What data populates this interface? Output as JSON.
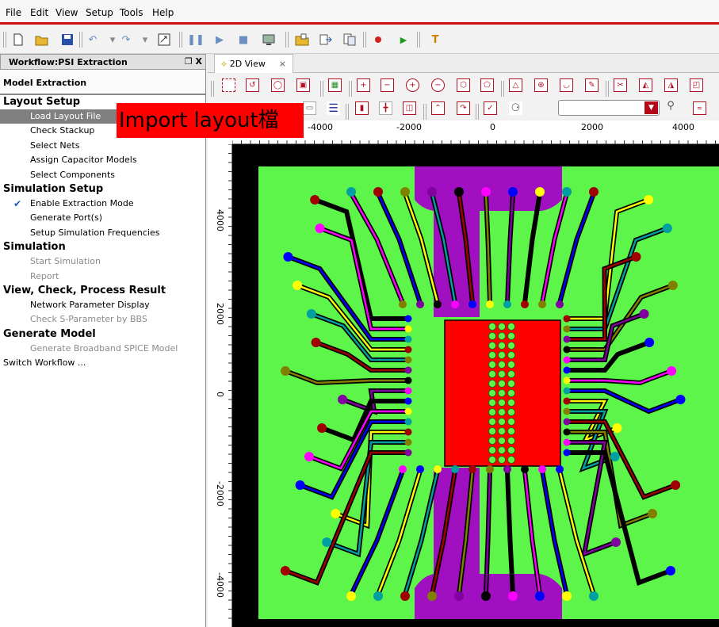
{
  "menu": [
    "File",
    "Edit",
    "View",
    "Setup",
    "Tools",
    "Help"
  ],
  "workflow": {
    "title": "Workflow:PSI Extraction",
    "controls": "❐ X",
    "header": "Model Extraction",
    "sections": [
      {
        "title": "Layout Setup",
        "items": [
          {
            "label": "Load Layout File",
            "state": "selected"
          },
          {
            "label": "Check Stackup",
            "state": "normal"
          },
          {
            "label": "Select Nets",
            "state": "normal"
          },
          {
            "label": "Assign Capacitor Models",
            "state": "normal"
          },
          {
            "label": "Select Components",
            "state": "normal"
          }
        ]
      },
      {
        "title": "Simulation Setup",
        "items": [
          {
            "label": "Enable Extraction Mode",
            "state": "checked"
          },
          {
            "label": "Generate Port(s)",
            "state": "normal"
          },
          {
            "label": "Setup Simulation Frequencies",
            "state": "normal"
          }
        ]
      },
      {
        "title": "Simulation",
        "items": [
          {
            "label": "Start Simulation",
            "state": "disabled"
          },
          {
            "label": "Report",
            "state": "disabled"
          }
        ]
      },
      {
        "title": "View, Check, Process Result",
        "items": [
          {
            "label": "Network Parameter Display",
            "state": "normal"
          },
          {
            "label": "Check S-Parameter by BBS",
            "state": "disabled"
          }
        ]
      },
      {
        "title": "Generate Model",
        "items": [
          {
            "label": "Generate Broadband SPICE Model",
            "state": "disabled"
          }
        ]
      }
    ],
    "footer": "Switch Workflow ..."
  },
  "view": {
    "tab_label": "2D View",
    "tab_close": "×",
    "search_value": ""
  },
  "ruler": {
    "h_labels": [
      "-4000",
      "-2000",
      "0",
      "2000",
      "4000"
    ],
    "v_labels": [
      "4000",
      "2000",
      "0",
      "-2000",
      "-4000"
    ]
  },
  "callout": "Import layout檔",
  "colors": {
    "board": "#5df54a",
    "die": "#ff0000",
    "plane": "#a010c0",
    "trace": "#000000",
    "accent": "#cc1010"
  },
  "icons": {
    "toolbar": [
      "new-icon",
      "open-icon",
      "save-icon",
      "undo-icon",
      "redo-icon",
      "zoom-fit-icon",
      "pause-icon",
      "play-icon",
      "stop-icon",
      "monitor-icon",
      "folder-icon",
      "export-icon",
      "record-icon",
      "run-icon",
      "text-icon"
    ],
    "search": "search-icon"
  }
}
